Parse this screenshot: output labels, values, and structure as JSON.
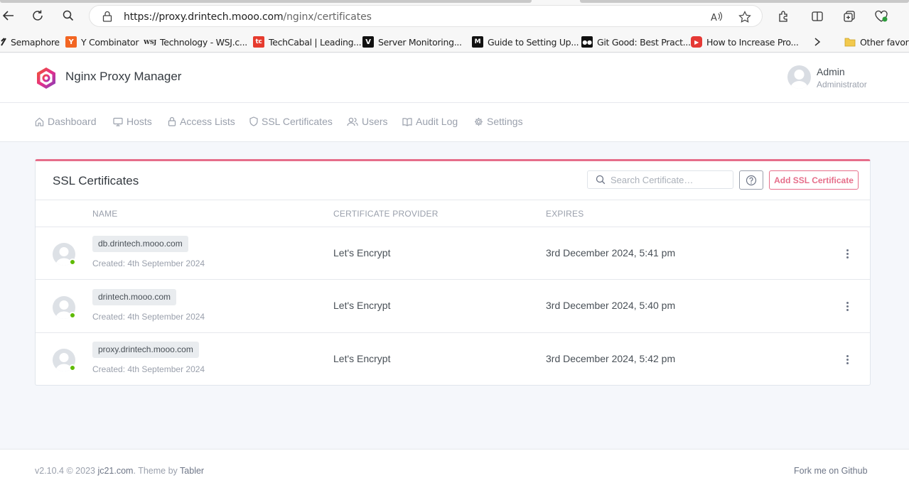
{
  "browser": {
    "url_host": "https://proxy.drintech.mooo.com",
    "url_path": "/nginx/certificates",
    "bookmarks": [
      {
        "label": "Semaphore",
        "icon": "semaphore-icon"
      },
      {
        "label": "Y Combinator",
        "icon": "ycombinator-icon"
      },
      {
        "label": "Technology - WSJ.c...",
        "icon": "wsj-icon"
      },
      {
        "label": "TechCabal | Leading...",
        "icon": "techcabal-icon"
      },
      {
        "label": "Server Monitoring...",
        "icon": "vercel-icon"
      },
      {
        "label": "Guide to Setting Up...",
        "icon": "medium-icon"
      },
      {
        "label": "Git Good: Best Pract...",
        "icon": "medium-icon"
      },
      {
        "label": "How to Increase Pro...",
        "icon": "youtube-icon"
      }
    ],
    "other_favorites": "Other favorite"
  },
  "app": {
    "title": "Nginx Proxy Manager",
    "user_name": "Admin",
    "user_role": "Administrator",
    "accent": "#e66e8a"
  },
  "nav": [
    {
      "label": "Dashboard",
      "icon": "home-icon"
    },
    {
      "label": "Hosts",
      "icon": "monitor-icon"
    },
    {
      "label": "Access Lists",
      "icon": "lock-icon"
    },
    {
      "label": "SSL Certificates",
      "icon": "shield-icon"
    },
    {
      "label": "Users",
      "icon": "users-icon"
    },
    {
      "label": "Audit Log",
      "icon": "book-icon"
    },
    {
      "label": "Settings",
      "icon": "gear-icon"
    }
  ],
  "card": {
    "title": "SSL Certificates",
    "search_placeholder": "Search Certificate…",
    "add_label": "Add SSL Certificate",
    "columns": [
      "Name",
      "Certificate Provider",
      "Expires"
    ],
    "rows": [
      {
        "domain": "db.drintech.mooo.com",
        "created": "Created: 4th September 2024",
        "provider": "Let's Encrypt",
        "expires": "3rd December 2024, 5:41 pm"
      },
      {
        "domain": "drintech.mooo.com",
        "created": "Created: 4th September 2024",
        "provider": "Let's Encrypt",
        "expires": "3rd December 2024, 5:40 pm"
      },
      {
        "domain": "proxy.drintech.mooo.com",
        "created": "Created: 4th September 2024",
        "provider": "Let's Encrypt",
        "expires": "3rd December 2024, 5:42 pm"
      }
    ]
  },
  "footer": {
    "version": "v2.10.4 © 2023",
    "author": "jc21.com",
    "theme_by": ". Theme by",
    "theme": "Tabler",
    "fork": "Fork me on Github"
  }
}
